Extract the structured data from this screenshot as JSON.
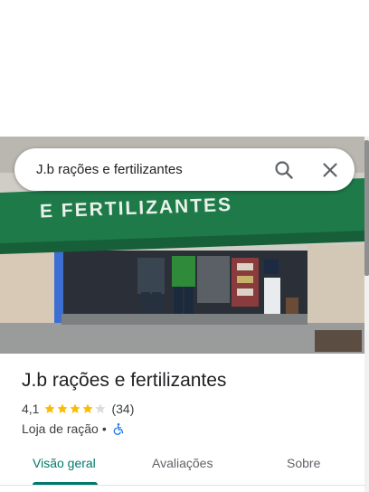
{
  "search": {
    "query": "J.b rações e fertilizantes",
    "search_icon": "search-icon",
    "close_icon": "close-icon"
  },
  "photo": {
    "awning_text": "E FERTILIZANTES",
    "awning_color": "#1f7a4a"
  },
  "place": {
    "name": "J.b rações e fertilizantes",
    "rating": "4,1",
    "stars": 4.1,
    "reviews": "(34)",
    "category": "Loja de ração",
    "separator": "•",
    "accessibility_icon": "wheelchair-icon"
  },
  "tabs": [
    {
      "label": "Visão geral",
      "active": true
    },
    {
      "label": "Avaliações",
      "active": false
    },
    {
      "label": "Sobre",
      "active": false
    }
  ],
  "colors": {
    "accent": "#00796b",
    "star": "#fbbc04",
    "star_empty": "#dadce0",
    "accessibility": "#1a73e8"
  }
}
